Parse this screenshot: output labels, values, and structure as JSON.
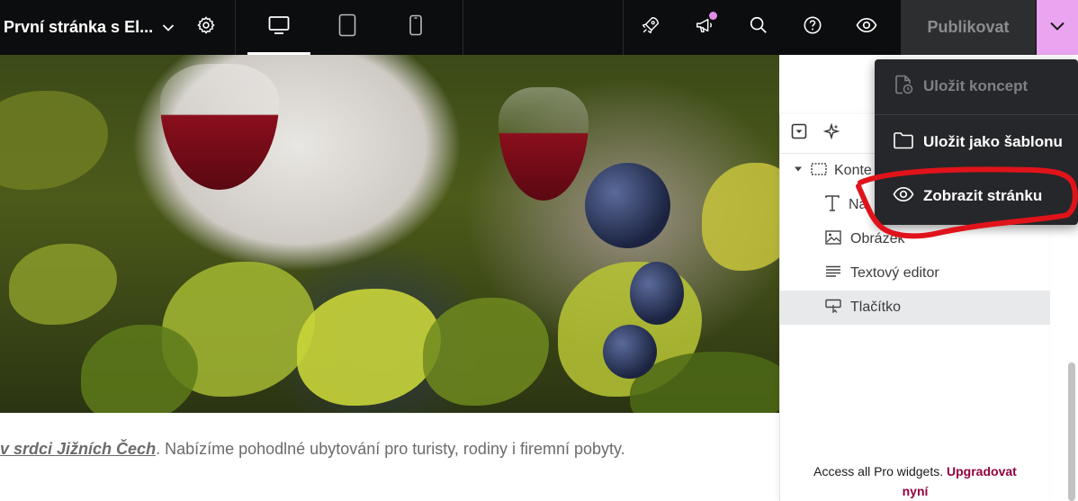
{
  "header": {
    "page_title": "První stránka s El...",
    "publish_label": "Publikovat",
    "icons": [
      "chevron-down-icon",
      "gear-icon",
      "desktop-icon",
      "tablet-icon",
      "mobile-icon",
      "rocket-icon",
      "megaphone-icon",
      "search-icon",
      "help-icon",
      "eye-icon",
      "chevron-down-icon"
    ],
    "colors": {
      "bar": "#0c0d0e",
      "publish_bg": "#2d2e30",
      "caret_bg": "#eba4f0",
      "notification_dot": "#e08de8"
    }
  },
  "publish_menu": {
    "items": [
      {
        "label": "Uložit koncept",
        "icon": "draft-icon",
        "enabled": false
      },
      {
        "label": "Uložit jako šablonu",
        "icon": "folder-icon",
        "enabled": true
      },
      {
        "label": "Zobrazit stránku",
        "icon": "eye-icon",
        "enabled": true
      }
    ]
  },
  "navigator": {
    "items": [
      {
        "label": "Konte",
        "icon": "container-icon"
      },
      {
        "label": "Na",
        "icon": "heading-icon"
      },
      {
        "label": "Obrázek",
        "icon": "image-icon"
      },
      {
        "label": "Textový editor",
        "icon": "text-editor-icon"
      },
      {
        "label": "Tlačítko",
        "icon": "button-icon",
        "selected": true
      }
    ],
    "promo_text": "Access all Pro widgets.",
    "upgrade_label_1": "Upgradovat",
    "upgrade_label_2": "nyní"
  },
  "page": {
    "link_text": "v srdci Jižních Čech",
    "body_text": ". Nabízíme pohodlné ubytování pro turisty, rodiny i firemní pobyty."
  }
}
